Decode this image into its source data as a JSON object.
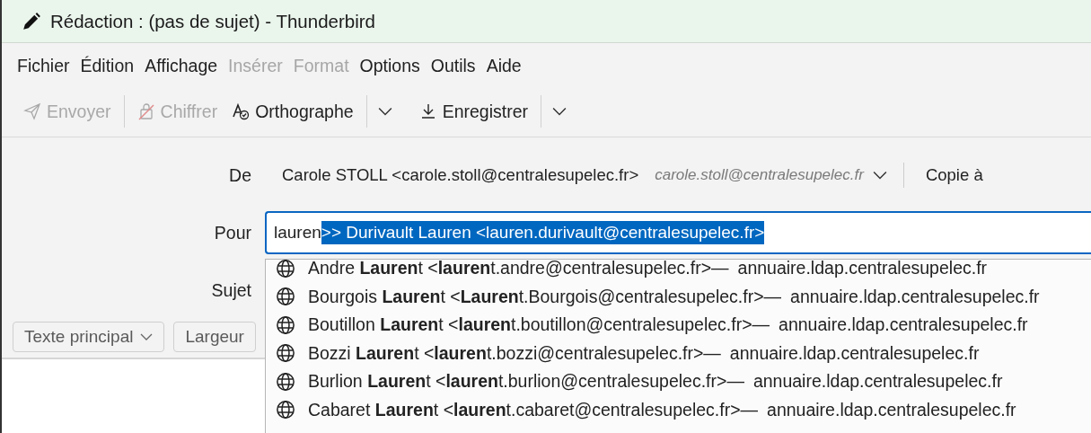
{
  "window": {
    "title": "Rédaction : (pas de sujet) - Thunderbird"
  },
  "menu": [
    {
      "label": "Fichier",
      "disabled": false
    },
    {
      "label": "Édition",
      "disabled": false
    },
    {
      "label": "Affichage",
      "disabled": false
    },
    {
      "label": "Insérer",
      "disabled": true
    },
    {
      "label": "Format",
      "disabled": true
    },
    {
      "label": "Options",
      "disabled": false
    },
    {
      "label": "Outils",
      "disabled": false
    },
    {
      "label": "Aide",
      "disabled": false
    }
  ],
  "toolbar": [
    {
      "kind": "send",
      "label": "Envoyer",
      "disabled": true,
      "dropdown": false
    },
    {
      "kind": "encrypt",
      "label": "Chiffrer",
      "disabled": true,
      "dropdown": false
    },
    {
      "kind": "spelling",
      "label": "Orthographe",
      "disabled": false,
      "dropdown": true
    },
    {
      "kind": "save",
      "label": "Enregistrer",
      "disabled": false,
      "dropdown": true
    }
  ],
  "header": {
    "from_label": "De",
    "from_value": "Carole STOLL <carole.stoll@centralesupelec.fr>",
    "from_identity": "carole.stoll@centralesupelec.fr",
    "cc_button": "Copie à",
    "to_label": "Pour",
    "to_typed": "lauren",
    "to_completion": ">> Durivault Lauren <lauren.durivault@centralesupelec.fr>",
    "subject_label": "Sujet"
  },
  "format_bar": {
    "paragraph": "Texte principal",
    "font": "Largeur"
  },
  "autocomplete": [
    {
      "entry": "Andre **Lauren**t <**lauren**t.andre@centralesupelec.fr>—",
      "source": "annuaire.ldap.centralesupelec.fr"
    },
    {
      "entry": "Bourgois **Lauren**t <**Lauren**t.Bourgois@centralesupelec.fr>—",
      "source": "annuaire.ldap.centralesupelec.fr"
    },
    {
      "entry": "Boutillon **Lauren**t <**lauren**t.boutillon@centralesupelec.fr>—",
      "source": "annuaire.ldap.centralesupelec.fr"
    },
    {
      "entry": "Bozzi **Lauren**t <**lauren**t.bozzi@centralesupelec.fr>—",
      "source": "annuaire.ldap.centralesupelec.fr"
    },
    {
      "entry": "Burlion **Lauren**t <**lauren**t.burlion@centralesupelec.fr>—",
      "source": "annuaire.ldap.centralesupelec.fr"
    },
    {
      "entry": "Cabaret **Lauren**t <**lauren**t.cabaret@centralesupelec.fr>—",
      "source": "annuaire.ldap.centralesupelec.fr"
    }
  ]
}
